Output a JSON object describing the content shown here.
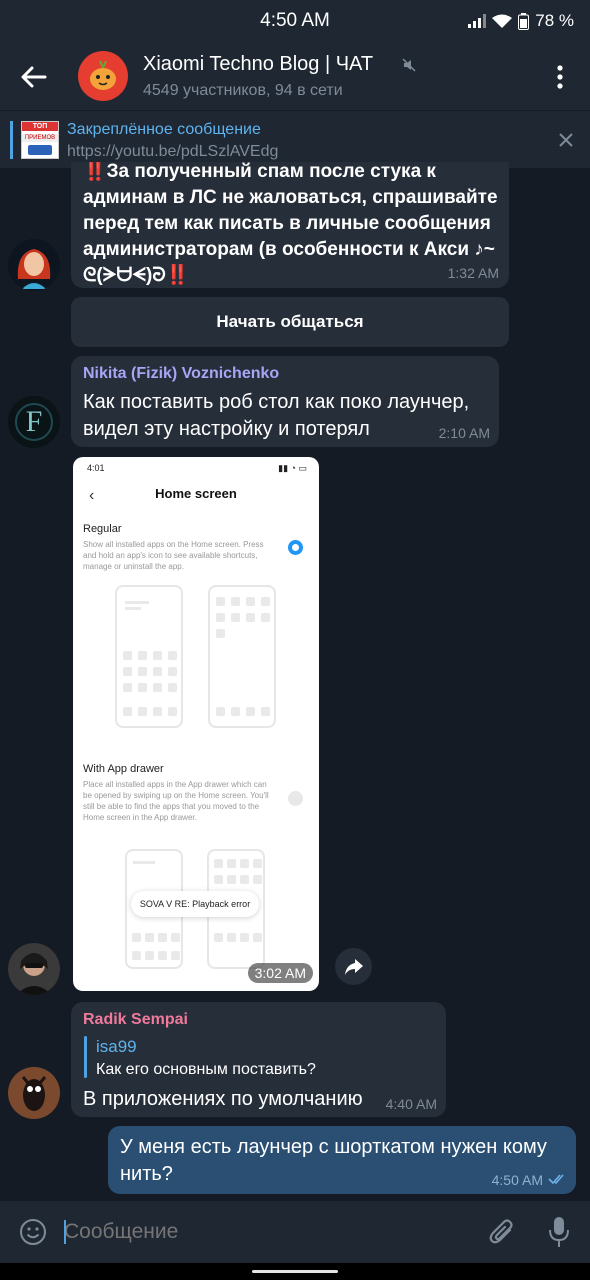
{
  "status_bar": {
    "time": "4:50 AM",
    "battery": "78 %"
  },
  "header": {
    "title": "Xiaomi Techno Blog | ЧАТ",
    "subtitle": "4549 участников, 94 в сети"
  },
  "pinned": {
    "label": "Закреплённое сообщение",
    "link": "https://youtu.be/pdLSzlAVEdg",
    "thumb_text": [
      "ТОП",
      "ПРИЕМОВ"
    ]
  },
  "messages": {
    "rules": {
      "lines": [
        "‼️За полученный спам после стука к",
        "админам в ЛС не жаловаться, спрашивайте",
        "перед тем как писать в личные сообщения",
        "администраторам (в особенности к Акси ♪~",
        "ᘓ(ᗒᗨᗕ)ᘒ‼️"
      ],
      "time": "1:32 AM"
    },
    "start_button": "Начать общаться",
    "nikita": {
      "sender": "Nikita (Fizik) Voznichenko",
      "lines": [
        "Как поставить роб стол как поко лаунчер,",
        "видел эту настройку и потерял"
      ],
      "time": "2:10 AM",
      "avatar_letter": "F"
    },
    "photo": {
      "status_time": "4:01",
      "title": "Home screen",
      "regular_title": "Regular",
      "regular_desc": "Show all installed apps on the Home screen. Press and hold an app's icon to see available shortcuts, manage or uninstall the app.",
      "drawer_title": "With App drawer",
      "drawer_desc": "Place all installed apps in the App drawer which can be opened by swiping up on the Home screen. You'll still be able to find the apps that you moved to the Home screen in the App drawer.",
      "toast": "SOVA V RE: Playback error",
      "time": "3:02 AM"
    },
    "radik": {
      "sender": "Radik Sempai",
      "reply_name": "isa99",
      "reply_text": "Как его основным поставить?",
      "text": "В приложениях по умолчанию",
      "time": "4:40 AM"
    },
    "outgoing": {
      "lines": [
        "У меня есть лаунчер с шорткатом нужен кому",
        "нить?"
      ],
      "time": "4:50 AM"
    }
  },
  "input": {
    "placeholder": "Сообщение"
  },
  "colors": {
    "background": "#151b24",
    "bar": "#1f2733",
    "bubble_in": "#262e3a",
    "bubble_out": "#2a4f73",
    "accent": "#4fa3e3",
    "nikita_name": "#a9a5f5",
    "radik_name": "#ef7a9b"
  }
}
